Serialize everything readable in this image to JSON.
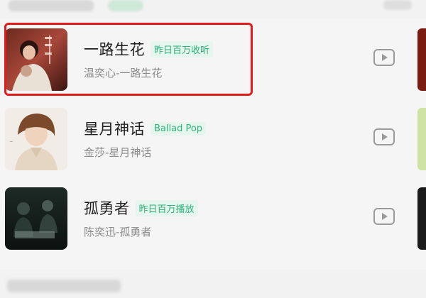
{
  "header": {
    "section_title_blurred": "",
    "chip_blurred": ""
  },
  "songs": [
    {
      "title": "一路生花",
      "tag": "昨日百万收听",
      "subtitle": "温奕心-一路生花",
      "cover_icon": "album-cover",
      "play_icon": "play-icon",
      "highlighted": true,
      "tag_color": "#2fb37a"
    },
    {
      "title": "星月神话",
      "tag": "Ballad Pop",
      "subtitle": "金莎-星月神话",
      "cover_icon": "album-cover",
      "play_icon": "play-icon",
      "highlighted": false,
      "tag_color": "#2fb37a"
    },
    {
      "title": "孤勇者",
      "tag": "昨日百万播放",
      "subtitle": "陈奕迅-孤勇者",
      "cover_icon": "album-cover",
      "play_icon": "play-icon",
      "highlighted": false,
      "tag_color": "#2fb37a"
    }
  ],
  "colors": {
    "accent_green": "#2fb37a",
    "tag_bg": "#e6f6ee",
    "highlight_red": "#e31b1b",
    "title_text": "#1e1e1e",
    "subtitle_text": "#8a8a8a"
  }
}
